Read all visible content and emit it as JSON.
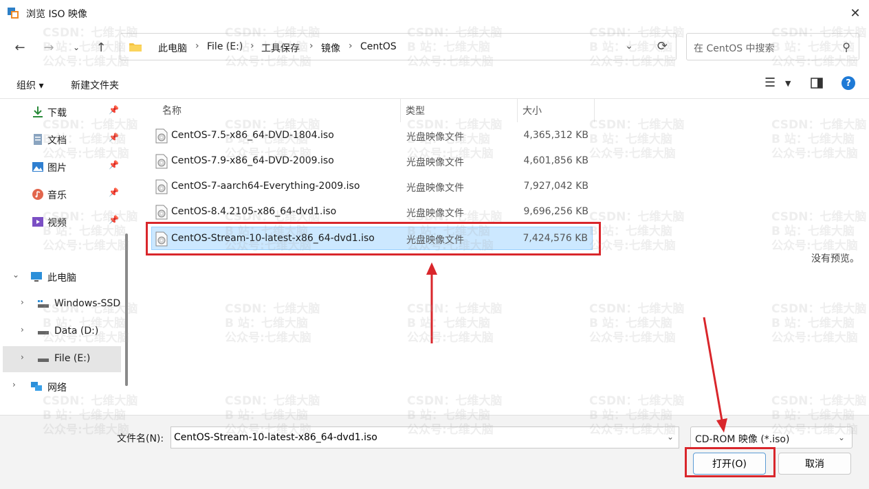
{
  "window": {
    "title": "浏览 ISO 映像",
    "close_label": "✕"
  },
  "nav": {
    "breadcrumbs": [
      "此电脑",
      "File (E:)",
      "工具保存",
      "镜像",
      "CentOS"
    ],
    "search_placeholder": "在 CentOS 中搜索"
  },
  "toolbar": {
    "organize_label": "组织 ▾",
    "new_folder_label": "新建文件夹"
  },
  "sidebar": {
    "quick": [
      {
        "label": "下载",
        "icon": "download-icon"
      },
      {
        "label": "文档",
        "icon": "document-icon"
      },
      {
        "label": "图片",
        "icon": "pictures-icon"
      },
      {
        "label": "音乐",
        "icon": "music-icon"
      },
      {
        "label": "视频",
        "icon": "video-icon"
      }
    ],
    "tree": [
      {
        "label": "此电脑",
        "icon": "computer-icon"
      },
      {
        "label": "Windows-SSD",
        "icon": "drive-icon"
      },
      {
        "label": "Data (D:)",
        "icon": "drive-icon"
      },
      {
        "label": "File (E:)",
        "icon": "drive-icon",
        "selected": true
      },
      {
        "label": "网络",
        "icon": "network-icon"
      }
    ]
  },
  "columns": {
    "name": "名称",
    "type": "类型",
    "size": "大小"
  },
  "files": [
    {
      "name": "CentOS-7.5-x86_64-DVD-1804.iso",
      "type": "光盘映像文件",
      "size": "4,365,312 KB"
    },
    {
      "name": "CentOS-7.9-x86_64-DVD-2009.iso",
      "type": "光盘映像文件",
      "size": "4,601,856 KB"
    },
    {
      "name": "CentOS-7-aarch64-Everything-2009.iso",
      "type": "光盘映像文件",
      "size": "7,927,042 KB"
    },
    {
      "name": "CentOS-8.4.2105-x86_64-dvd1.iso",
      "type": "光盘映像文件",
      "size": "9,696,256 KB"
    },
    {
      "name": "CentOS-Stream-10-latest-x86_64-dvd1.iso",
      "type": "光盘映像文件",
      "size": "7,424,576 KB",
      "selected": true
    }
  ],
  "preview": {
    "empty_text": "没有预览。"
  },
  "footer": {
    "filename_label": "文件名(N):",
    "filename_value": "CentOS-Stream-10-latest-x86_64-dvd1.iso",
    "filetype_value": "CD-ROM 映像 (*.iso)",
    "open_label": "打开(O)",
    "cancel_label": "取消"
  },
  "watermark": [
    "CSDN：七维大脑",
    "B 站：七维大脑",
    "公众号:七维大脑"
  ],
  "colors": {
    "accent": "#1e7ad6",
    "selection": "#cce8ff",
    "annotation": "#d9262b"
  }
}
